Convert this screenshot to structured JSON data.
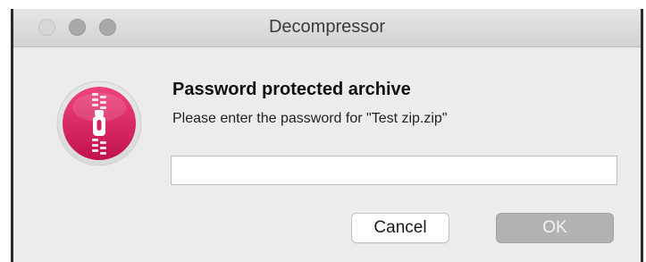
{
  "window": {
    "title": "Decompressor"
  },
  "dialog": {
    "heading": "Password protected archive",
    "message": "Please enter the password for \"Test zip.zip\"",
    "password_value": "",
    "password_placeholder": ""
  },
  "buttons": {
    "cancel_label": "Cancel",
    "ok_label": "OK"
  },
  "icons": {
    "app_icon": "zipper-archive-icon",
    "close": "close-button-inactive",
    "minimize": "minimize-button-inactive",
    "zoom": "zoom-button-inactive"
  },
  "colors": {
    "app_icon_gradient_top": "#f0447e",
    "app_icon_gradient_bottom": "#c0124f",
    "ok_button_disabled": "#b2b2b2",
    "dialog_background": "#ececec"
  }
}
